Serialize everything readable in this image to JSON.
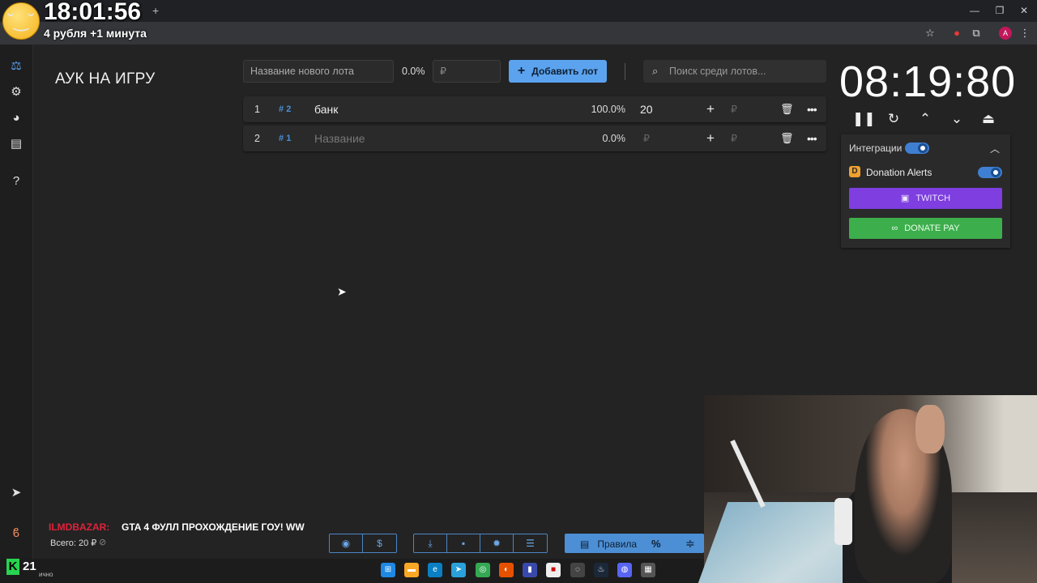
{
  "overlay": {
    "clock": "18:01:56",
    "subtitle": "4 рубля +1 минута"
  },
  "browser": {
    "new_tab": "+",
    "minimize": "—",
    "restore": "❐",
    "close": "✕",
    "profile_initial": "A"
  },
  "page": {
    "title": "АУК НА ИГРУ"
  },
  "toolbar": {
    "lot_name_placeholder": "Название нового лота",
    "percent": "0.0%",
    "amount_placeholder": "₽",
    "add_button": "Добавить лот",
    "search_placeholder": "Поиск среди лотов..."
  },
  "lots": [
    {
      "index": "1",
      "id": "2",
      "name": "банк",
      "percent": "100.0%",
      "amount": "20",
      "currency": "₽"
    },
    {
      "index": "2",
      "id": "1",
      "name": "Название",
      "percent": "0.0%",
      "amount": "₽",
      "currency": "₽"
    }
  ],
  "timer": {
    "value": "08:19:80"
  },
  "integrations": {
    "title": "Интеграции",
    "enabled": true,
    "donation_alerts": "Donation Alerts",
    "twitch": "TWITCH",
    "donate_pay": "DONATE PAY"
  },
  "chat": {
    "user": "ILMDBAZAR:",
    "message": "GTA 4 ФУЛЛ ПРОХОЖДЕНИЕ ГОУ! WW"
  },
  "footer": {
    "total": "Всего: 20 ₽",
    "rules": "Правила",
    "percent_btn": "%"
  },
  "kick": {
    "logo": "K",
    "count": "21",
    "sub": "ично"
  },
  "colors": {
    "accent": "#5ba3ee",
    "twitch": "#7e3ee0",
    "donate_pay": "#3dae4c",
    "chat_user": "#e0223b"
  }
}
